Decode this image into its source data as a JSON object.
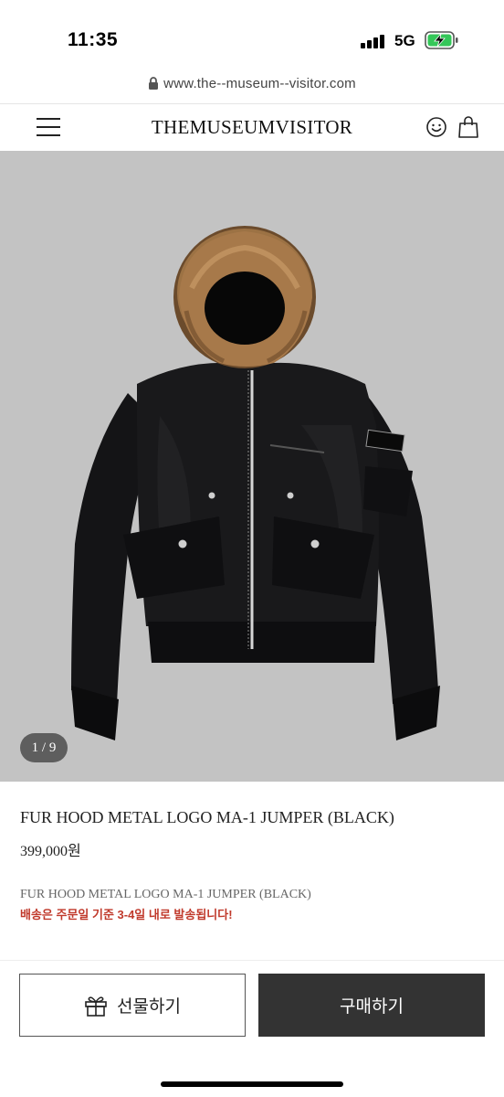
{
  "status_bar": {
    "time": "11:35",
    "network": "5G",
    "battery_icon": "battery-charging-icon"
  },
  "browser": {
    "url": "www.the--museum--visitor.com",
    "lock_icon": "lock-icon"
  },
  "header": {
    "title": "THEMUSEUMVISITOR",
    "menu_icon": "hamburger-menu-icon",
    "account_icon": "smile-icon",
    "cart_icon": "shopping-bag-icon"
  },
  "product": {
    "image_counter": "1 / 9",
    "name": "FUR HOOD METAL LOGO MA-1 JUMPER (BLACK)",
    "price": "399,000원",
    "subtitle": "FUR HOOD METAL LOGO MA-1 JUMPER (BLACK)",
    "shipping_note": "배송은 주문일 기준 3-4일 내로 발송됩니다!"
  },
  "actions": {
    "gift_label": "선물하기",
    "gift_icon": "gift-icon",
    "buy_label": "구매하기"
  },
  "colors": {
    "accent_red": "#c0392b",
    "buy_button": "#333333",
    "image_background": "#c3c3c3"
  }
}
